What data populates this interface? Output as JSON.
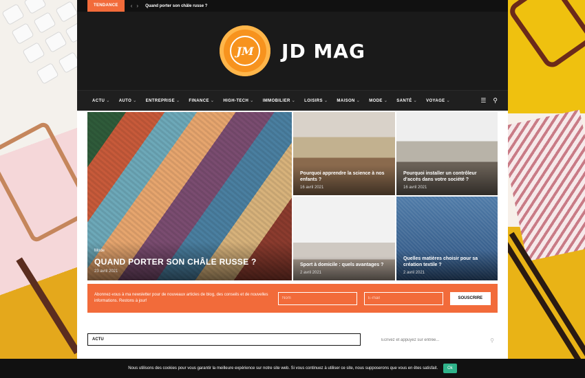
{
  "topbar": {
    "badge": "TENDANCE",
    "headline": "Quand porter son châle russe ?"
  },
  "header": {
    "logo_initials": "JM",
    "site_name": "JD MAG"
  },
  "nav": {
    "items": [
      "ACTU",
      "AUTO",
      "ENTREPRISE",
      "FINANCE",
      "HIGH-TECH",
      "IMMOBILIER",
      "LOISIRS",
      "MAISON",
      "MODE",
      "SANTÉ",
      "VOYAGE"
    ]
  },
  "featured": {
    "main": {
      "category": "Mode",
      "title": "QUAND PORTER SON CHÂLE RUSSE ?",
      "date": "23 avril 2021"
    },
    "cards": [
      {
        "title": "Pourquoi apprendre la science à nos enfants ?",
        "date": "16 avril 2021"
      },
      {
        "title": "Pourquoi installer un contrôleur d'accès dans votre société ?",
        "date": "16 avril 2021"
      },
      {
        "title": "Sport à domicile : quels avantages ?",
        "date": "2 avril 2021"
      },
      {
        "title": "Quelles matières choisir pour sa création textile ?",
        "date": "2 avril 2021"
      }
    ]
  },
  "newsletter": {
    "text": "Abonnez-vous à ma newsletter pour de nouveaux articles de blog, des conseils et de nouvelles informations. Restons à jour!",
    "name_placeholder": "Nom",
    "email_placeholder": "E-mail",
    "button": "SOUSCRIRE"
  },
  "section": {
    "title": "ACTU"
  },
  "search": {
    "placeholder": "Ecrivez et appuyez sur entrée..."
  },
  "cookie": {
    "text": "Nous utilisons des cookies pour vous garantir la meilleure expérience sur notre site web. Si vous continuez à utiliser ce site, nous supposerons que vous en êtes satisfait.",
    "ok": "Ok"
  },
  "colors": {
    "accent": "#f26b3a",
    "dark": "#1a1a1a",
    "cookie_ok": "#2fb38a"
  }
}
